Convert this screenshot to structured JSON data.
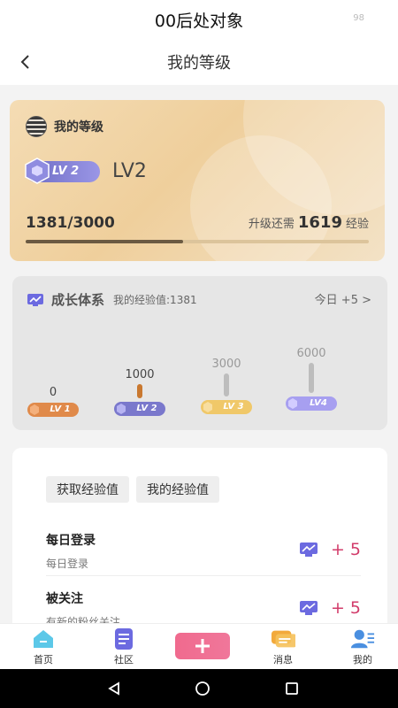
{
  "status": {
    "title": "00后处对象",
    "indicator": "98"
  },
  "nav": {
    "title": "我的等级",
    "back_icon": "chevron-left-icon"
  },
  "level_card": {
    "title": "我的等级",
    "badge_label": "LV 2",
    "level_text": "LV2",
    "progress_text": "1381/3000",
    "progress_fraction": 0.46,
    "need_prefix": "升级还需",
    "need_value": "1619",
    "need_suffix": "经验"
  },
  "growth": {
    "title": "成长体系",
    "exp_text": "我的经验值:1381",
    "today_text": "今日 +5 >",
    "levels": [
      {
        "value": "0",
        "label": "LV 1",
        "color": "#e08a4a"
      },
      {
        "value": "1000",
        "label": "LV 2",
        "color": "#7a78cc"
      },
      {
        "value": "3000",
        "label": "LV 3",
        "color": "#f0c869"
      },
      {
        "value": "6000",
        "label": "LV4",
        "color": "#a79ff0"
      }
    ]
  },
  "tasks": {
    "tabs": [
      "获取经验值",
      "我的经验值"
    ],
    "items": [
      {
        "name": "每日登录",
        "desc": "每日登录",
        "reward": "+ 5"
      },
      {
        "name": "被关注",
        "desc": "有新的粉丝关注",
        "reward": "+ 5"
      }
    ]
  },
  "tabbar": {
    "items": [
      {
        "label": "首页",
        "icon": "home-icon"
      },
      {
        "label": "社区",
        "icon": "community-icon"
      },
      {
        "label": "消息",
        "icon": "message-icon"
      },
      {
        "label": "我的",
        "icon": "profile-icon"
      }
    ],
    "plus_icon": "plus-icon"
  },
  "colors": {
    "accent_pink": "#d23c6b",
    "gold": "#efcf9c",
    "purple": "#7a78cc"
  }
}
